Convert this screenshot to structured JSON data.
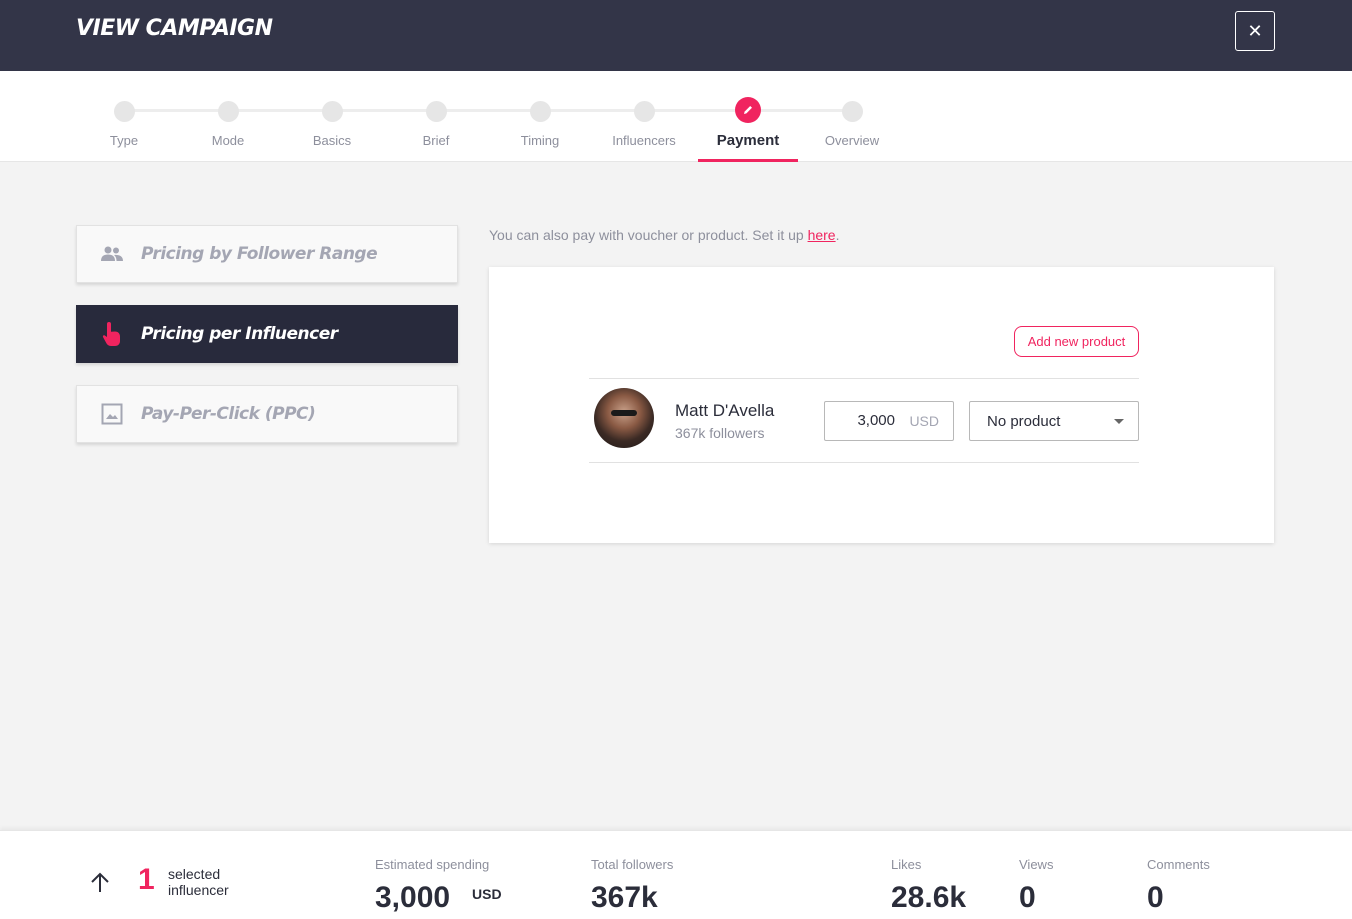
{
  "header": {
    "title": "VIEW CAMPAIGN",
    "close_icon": "close-icon"
  },
  "stepper": {
    "steps": [
      {
        "label": "Type"
      },
      {
        "label": "Mode"
      },
      {
        "label": "Basics"
      },
      {
        "label": "Brief"
      },
      {
        "label": "Timing"
      },
      {
        "label": "Influencers"
      },
      {
        "label": "Payment"
      },
      {
        "label": "Overview"
      }
    ],
    "active": "Payment",
    "active_icon": "pencil-icon"
  },
  "pricing_options": [
    {
      "label": "Pricing by Follower Range",
      "icon": "people-icon",
      "selected": false
    },
    {
      "label": "Pricing per Influencer",
      "icon": "touch-icon",
      "selected": true
    },
    {
      "label": "Pay-Per-Click (PPC)",
      "icon": "image-icon",
      "selected": false
    }
  ],
  "note": {
    "text": "You can also pay with voucher or product. Set it up ",
    "link": "here",
    "end": "."
  },
  "card": {
    "add_product_label": "Add new product",
    "influencer": {
      "name": "Matt D'Avella",
      "followers": "367k followers",
      "price": "3,000",
      "currency": "USD",
      "product": "No product"
    }
  },
  "footer": {
    "selected_count": "1",
    "selected_label": "selected influencer",
    "estimated_spending_label": "Estimated spending",
    "estimated_spending_value": "3,000",
    "estimated_spending_unit": "USD",
    "total_followers_label": "Total followers",
    "total_followers_value": "367k",
    "likes_label": "Likes",
    "likes_value": "28.6k",
    "views_label": "Views",
    "views_value": "0",
    "comments_label": "Comments",
    "comments_value": "0"
  },
  "colors": {
    "accent": "#f0245f",
    "header_bg": "#333548",
    "selected_option_bg": "#282a3c"
  }
}
